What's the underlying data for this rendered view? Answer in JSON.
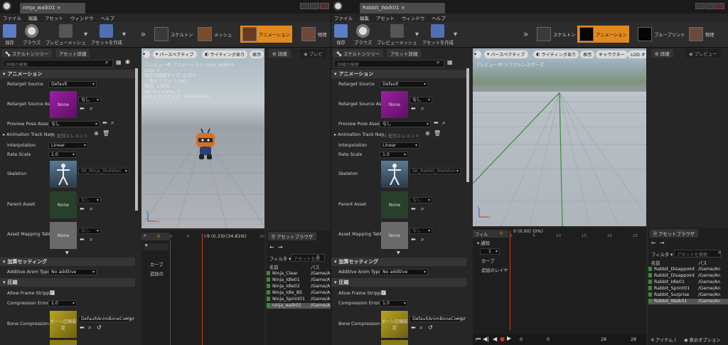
{
  "left": {
    "title_tab": "ninja_walk01",
    "menu": [
      "ファイル",
      "編集",
      "アセット",
      "ウィンドウ",
      "ヘルプ"
    ],
    "toolbar": {
      "save": "保存",
      "browse": "ブラウズ",
      "preview_mesh": "プレビューメッシュ",
      "create_asset": "アセットを作成",
      "modes": [
        "スケルトン",
        "メッシュ",
        "アニメーション",
        "物理"
      ]
    },
    "panel_tabs": [
      "スケルトンツリー",
      "アセット詳細"
    ],
    "search_placeholder": "詳細の検索",
    "sec_animation": "アニメーション",
    "retarget_source_label": "Retarget Source",
    "retarget_source_value": "Default",
    "retarget_source_asset_label": "Retarget Source Ass",
    "none_thumb": "None",
    "nashi": "なし",
    "preview_pose_label": "Preview Pose Asset",
    "preview_pose_value": "なし",
    "anim_track_label": "Animation Track Nam",
    "anim_track_value": "35 配列エレメント",
    "interp_label": "Interpolation",
    "interp_value": "Linear",
    "rate_label": "Rate Scale",
    "rate_value": "1.0",
    "skeleton_label": "Skeleton",
    "skeleton_value": "SK_Ninja_Skeleton",
    "parent_label": "Parent Asset",
    "asset_map_label": "Asset Mapping Table",
    "sec_additive": "加算セッティング",
    "additive_label": "Additive Anim Type",
    "additive_value": "No additive",
    "sec_compress": "圧縮",
    "allow_strip_label": "Allow Frame Strippin",
    "comp_err_label": "Compression Error T",
    "comp_err_value": "1.0",
    "bone_comp_label": "Bone Compression S",
    "bone_comp_value": "DefaultAnimBoneCompr",
    "bone_thumb": "ボーン圧縮設定",
    "vp_tabs": [
      "パースペクティブ",
      "ライティングあり",
      "表示"
    ],
    "right_tabs": [
      "詳細",
      "プレビ"
    ],
    "overlay": [
      "プレビュー中 アニメーション ninja_walk01",
      "LOD: 0",
      "現在の画面サイズ: 0.373",
      "三角ポリゴン: 1,941",
      "頂点: 1,563",
      "UV チャンネル: 1",
      "おおよそのサイズ: 148x26x143"
    ],
    "timeline": {
      "frame": "9",
      "label": "9 (0.33) (34.81%)",
      "ticks": [
        "0",
        "4",
        "8",
        "10",
        "15",
        "20"
      ],
      "tracks": [
        "カーブ",
        "追加の"
      ]
    },
    "asset_browser": {
      "tab": "アセットブラウザ",
      "filter": "フィルタ",
      "search": "アセットを検",
      "col_name": "名前",
      "col_path": "パス",
      "items": [
        {
          "name": "Ninja_Clear",
          "path": "/Game/A"
        },
        {
          "name": "Ninja_Idle01",
          "path": "/Game/A"
        },
        {
          "name": "Ninja_Idle02",
          "path": "/Game/A"
        },
        {
          "name": "Ninja_Idle_BS",
          "path": "/Game/A"
        },
        {
          "name": "Ninja_Sprint01",
          "path": "/Game/A"
        },
        {
          "name": "ninja_walk01",
          "path": "/Game/A"
        }
      ]
    }
  },
  "right": {
    "title_tab": "Rabbit_Walk01",
    "menu": [
      "ファイル",
      "編集",
      "アセット",
      "ウィンドウ",
      "ヘルプ"
    ],
    "toolbar": {
      "save": "保存",
      "browse": "ブラウズ",
      "preview_mesh": "プレビューメッシュ",
      "create_asset": "アセットを作成",
      "modes": [
        "スケルトン",
        "アニメーション",
        "ブループリント",
        "物理"
      ]
    },
    "panel_tabs": [
      "スケルトンツリー",
      "アセット詳細"
    ],
    "search_placeholder": "詳細の検索",
    "sec_animation": "アニメーション",
    "retarget_source_label": "Retarget Source",
    "retarget_source_value": "Default",
    "retarget_source_asset_label": "Retarget Source Ass",
    "none_thumb": "None",
    "nashi": "なし",
    "preview_pose_label": "Preview Pose Asset",
    "preview_pose_value": "なし",
    "anim_track_label": "Animation Track Nan",
    "anim_track_value": "24 配列エレメント",
    "interp_label": "Interpolation",
    "interp_value": "Linear",
    "rate_label": "Rate Scale",
    "rate_value": "1.0",
    "skeleton_label": "Skeleton",
    "skeleton_value": "SK_Rabbit_Skeleton",
    "parent_label": "Parent Asset",
    "asset_map_label": "Asset Mapping Table",
    "sec_additive": "加算セッティング",
    "additive_label": "Additive Anim Type",
    "additive_value": "No additive",
    "sec_compress": "圧縮",
    "allow_strip_label": "Allow Frame Strippin",
    "comp_err_label": "Compression Error T",
    "comp_err_value": "1.0",
    "bone_comp_label": "Bone Compression S",
    "bone_comp_value": "DefaultAnimBoneCompr",
    "bone_thumb": "ボーン圧縮設定",
    "vp_tabs": [
      "パースペクティブ",
      "ライティングあり",
      "表示",
      "キャラクター",
      "LOD オ"
    ],
    "right_tabs": [
      "詳細",
      "プレビュー"
    ],
    "overlay": [
      "プレビュー中 リファレンスポーズ"
    ],
    "timeline": {
      "frame": "0",
      "label": "0 (0.00) (0%)",
      "ticks": [
        "0",
        "5",
        "10",
        "15",
        "20",
        "25"
      ],
      "tracks": [
        "通知",
        "1",
        "カーブ",
        "追加のレイヤ"
      ],
      "filter": "フィル",
      "bottom_values": [
        "0",
        "0",
        "28",
        "28"
      ]
    },
    "asset_browser": {
      "tab": "アセットブラウザ",
      "filter": "フィルタ",
      "search": "アセットを検索",
      "col_name": "名前",
      "col_path": "パス",
      "items": [
        {
          "name": "Rabbit_Disappoint",
          "path": "/Game/An"
        },
        {
          "name": "Rabbit_Disappoint",
          "path": "/Game/An"
        },
        {
          "name": "Rabbit_Idle01",
          "path": "/Game/An"
        },
        {
          "name": "Rabbit_Sprint01",
          "path": "/Game/An"
        },
        {
          "name": "Rabbit_Surprise",
          "path": "/Game/An"
        },
        {
          "name": "Rabbit_Walk01",
          "path": "/Game/An"
        }
      ],
      "count": "6 アイテム (",
      "view_options": "表示オプション"
    }
  }
}
